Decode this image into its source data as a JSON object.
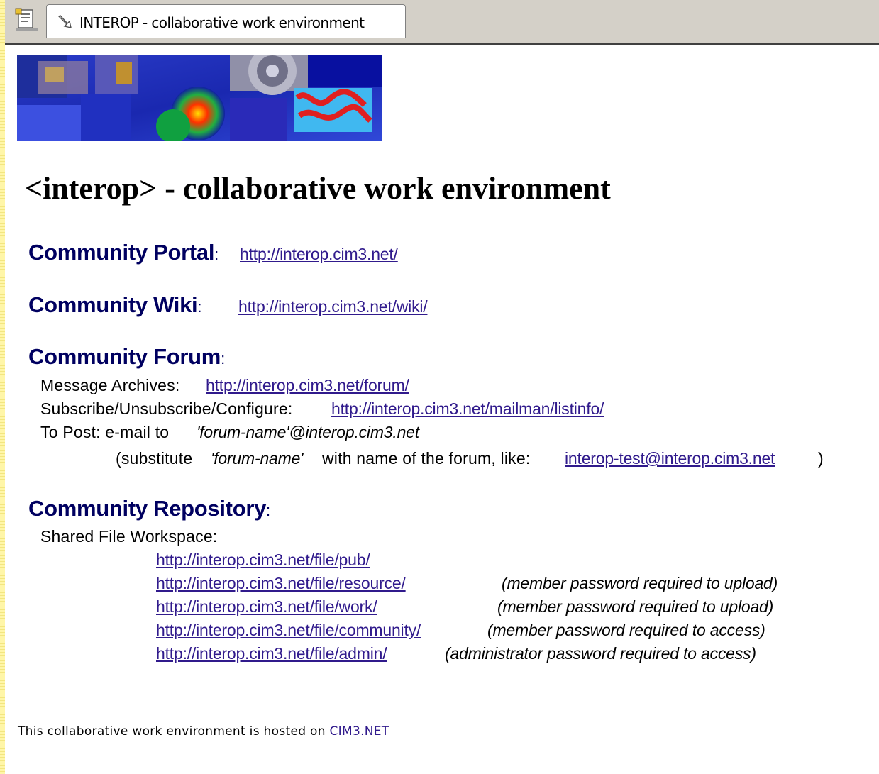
{
  "tab": {
    "title": "INTEROP - collaborative work environment"
  },
  "icons": {
    "page": "document-page-icon",
    "tab": "link-page-icon"
  },
  "page_title": "<interop> - collaborative work environment",
  "portal": {
    "heading": "Community Portal",
    "colon": ":",
    "url": "http://interop.cim3.net/"
  },
  "wiki": {
    "heading": "Community Wiki",
    "colon": ":",
    "url": "http://interop.cim3.net/wiki/"
  },
  "forum": {
    "heading": "Community Forum",
    "colon": ":",
    "archives_label": "Message Archives:",
    "archives_url": "http://interop.cim3.net/forum/",
    "subscribe_label": "Subscribe/Unsubscribe/Configure:",
    "subscribe_url": "http://interop.cim3.net/mailman/listinfo/",
    "post_label": "To Post: e-mail to",
    "post_address": "'forum-name'@interop.cim3.net",
    "sub_prefix": "(substitute",
    "sub_name": "'forum-name'",
    "sub_middle": "with name of the forum, like:",
    "sub_example": "interop-test@interop.cim3.net",
    "sub_close": ")"
  },
  "repository": {
    "heading": "Community Repository",
    "colon": ":",
    "workspace_label": "Shared File Workspace:",
    "links": [
      {
        "url": "http://interop.cim3.net/file/pub/",
        "note": ""
      },
      {
        "url": "http://interop.cim3.net/file/resource/",
        "note": "(member password required to upload)"
      },
      {
        "url": "http://interop.cim3.net/file/work/",
        "note": "(member password required to upload)"
      },
      {
        "url": "http://interop.cim3.net/file/community/",
        "note": "(member password required to access)"
      },
      {
        "url": "http://interop.cim3.net/file/admin/",
        "note": "(administrator password required to access)"
      }
    ]
  },
  "footer": {
    "text": "This collaborative work environment is hosted on",
    "link": "CIM3.NET"
  },
  "colors": {
    "heading": "#000060",
    "link": "#301a8c",
    "chrome": "#d4d0c8",
    "strip": "#fff6a8"
  }
}
